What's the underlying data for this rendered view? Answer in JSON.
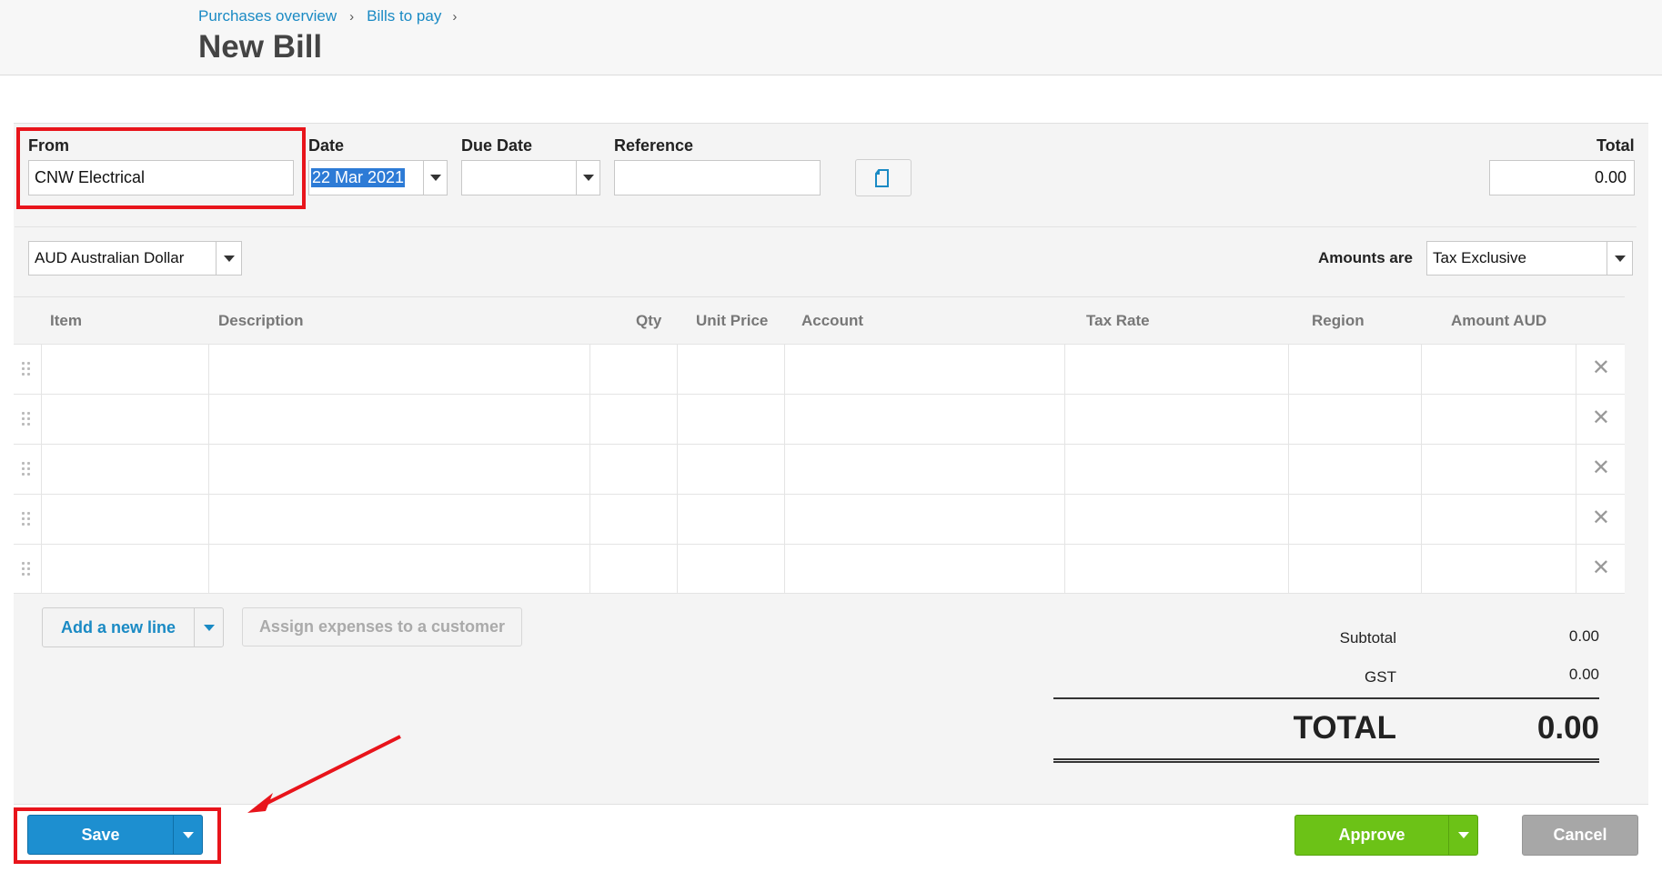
{
  "breadcrumb": {
    "item1": "Purchases overview",
    "item2": "Bills to pay",
    "sep": "›"
  },
  "page_title": "New Bill",
  "form": {
    "from_label": "From",
    "from_value": "CNW Electrical",
    "date_label": "Date",
    "date_value": "22 Mar 2021",
    "due_date_label": "Due Date",
    "due_date_value": "",
    "reference_label": "Reference",
    "reference_value": "",
    "total_label": "Total",
    "total_value": "0.00",
    "currency_value": "AUD Australian Dollar",
    "amounts_are_label": "Amounts are",
    "amounts_are_value": "Tax Exclusive"
  },
  "table": {
    "headers": {
      "item": "Item",
      "description": "Description",
      "qty": "Qty",
      "unit_price": "Unit Price",
      "account": "Account",
      "tax_rate": "Tax Rate",
      "region": "Region",
      "amount": "Amount AUD"
    },
    "row_count": 5,
    "delete_glyph": "✕"
  },
  "actions": {
    "add_line": "Add a new line",
    "assign_expenses": "Assign expenses to a customer"
  },
  "totals": {
    "subtotal_label": "Subtotal",
    "subtotal_value": "0.00",
    "gst_label": "GST",
    "gst_value": "0.00",
    "total_label": "TOTAL",
    "total_value": "0.00"
  },
  "footer": {
    "save": "Save",
    "approve": "Approve",
    "cancel": "Cancel"
  },
  "colors": {
    "link": "#1a8ac4",
    "save": "#1d8fd0",
    "approve": "#6cc217",
    "cancel": "#a7a7a7",
    "annotation": "#e8141b"
  },
  "icons": {
    "copy": "copy-icon",
    "dropdown": "caret-down-icon",
    "delete": "close-icon",
    "drag": "drag-handle-icon"
  }
}
